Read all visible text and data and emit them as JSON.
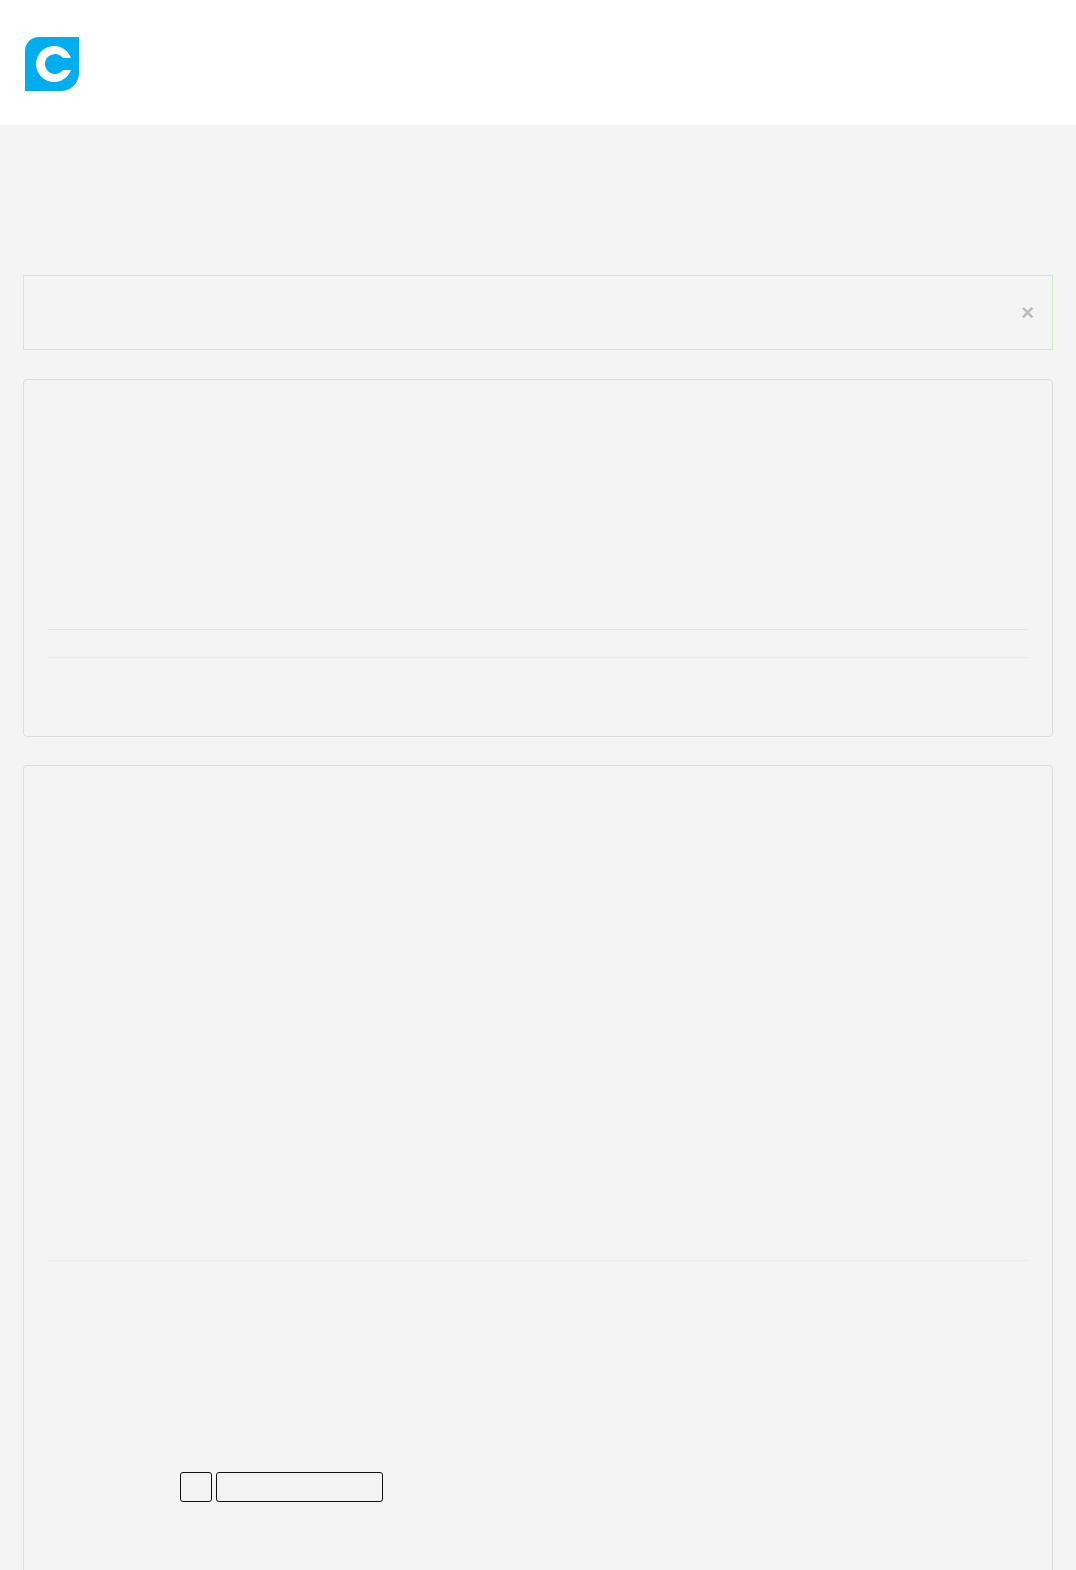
{
  "alert": {
    "close_label": "×"
  },
  "form": {
    "fields": [
      {
        "kind": "small"
      },
      {
        "kind": "wide"
      }
    ]
  }
}
